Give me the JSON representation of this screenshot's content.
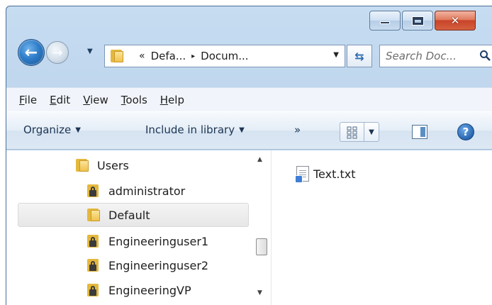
{
  "window": {
    "caption_buttons": [
      "minimize",
      "maximize",
      "close"
    ]
  },
  "navigation": {
    "back_icon": "back-arrow-icon",
    "forward_icon": "forward-arrow-icon",
    "address": {
      "overflow_chevron": "«",
      "breadcrumbs": [
        "Defa...",
        "Docum..."
      ],
      "separator": "▸"
    },
    "refresh_icon": "refresh-icon",
    "search": {
      "placeholder": "Search Doc...",
      "value": ""
    }
  },
  "menu": {
    "items": [
      {
        "mnemonic": "F",
        "rest": "ile"
      },
      {
        "mnemonic": "E",
        "rest": "dit"
      },
      {
        "mnemonic": "V",
        "rest": "iew"
      },
      {
        "mnemonic": "T",
        "rest": "ools"
      },
      {
        "mnemonic": "H",
        "rest": "elp"
      }
    ]
  },
  "commands": {
    "organize": "Organize",
    "include_in_library": "Include in library",
    "more": "»"
  },
  "tree": {
    "items": [
      {
        "label": "Users",
        "icon": "folder-icon",
        "selected": false
      },
      {
        "label": "administrator",
        "icon": "locked-folder-icon",
        "selected": false
      },
      {
        "label": "Default",
        "icon": "folder-icon",
        "selected": true
      },
      {
        "label": "Engineeringuser1",
        "icon": "locked-folder-icon",
        "selected": false
      },
      {
        "label": "Engineeringuser2",
        "icon": "locked-folder-icon",
        "selected": false
      },
      {
        "label": "EngineeringVP",
        "icon": "locked-folder-icon",
        "selected": false
      }
    ]
  },
  "files": {
    "items": [
      {
        "name": "Text.txt",
        "icon": "text-file-icon"
      }
    ]
  }
}
